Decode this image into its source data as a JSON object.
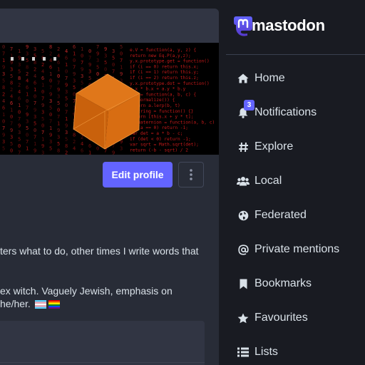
{
  "profile": {
    "edit_profile_label": "Edit profile",
    "bio_line_1": "ters what to do, other times I write words that",
    "bio_line_2": "ex witch. Vaguely Jewish, emphasis on",
    "bio_line_3": "he/her.",
    "header_image": {
      "code_lines": [
        "e.V = function(a, y, z) {",
        "return new Eq.P(a,y,z);",
        "y.x.prototype.get = function()",
        "if (i == 0) return this.x;",
        "if (i == 1) return this.y;",
        "if (i == 2) return this.z;",
        "y.x.prototype.dot = function()",
        "  a.x * b.x + a.y * b.y",
        "e.T = function(a, b, c) {",
        "(a.normalize()) {",
        "  return a.lerp(b, t)",
        "toString = function() {}",
        "return [this.x + y * t];",
        "e.Quaternion = function(a, b, c)",
        "if (a == 0) return -1;",
        "var det = a * b - c;",
        "if (det < 0) return -1;",
        "var sqrt = Math.sqrt(det);",
        "return (-b - sqrt) / 2"
      ],
      "glyph_columns": [
        "0",
        "7",
        "1",
        "9",
        "3",
        "5",
        "8",
        "2",
        "4",
        "6",
        "1",
        "0",
        "7",
        "9",
        "3",
        "5"
      ]
    },
    "colors": {
      "accent": "#6364ff",
      "cube": "#d4680f",
      "code": "#c41a1a"
    }
  },
  "nav": {
    "logo_text": "mastodon",
    "items": [
      {
        "label": "Home",
        "icon": "home-icon"
      },
      {
        "label": "Notifications",
        "icon": "bell-icon",
        "badge": "3"
      },
      {
        "label": "Explore",
        "icon": "hashtag-icon"
      },
      {
        "label": "Local",
        "icon": "users-icon"
      },
      {
        "label": "Federated",
        "icon": "globe-icon"
      },
      {
        "label": "Private mentions",
        "icon": "at-icon"
      },
      {
        "label": "Bookmarks",
        "icon": "bookmark-icon"
      },
      {
        "label": "Favourites",
        "icon": "star-icon"
      },
      {
        "label": "Lists",
        "icon": "list-icon"
      }
    ]
  }
}
